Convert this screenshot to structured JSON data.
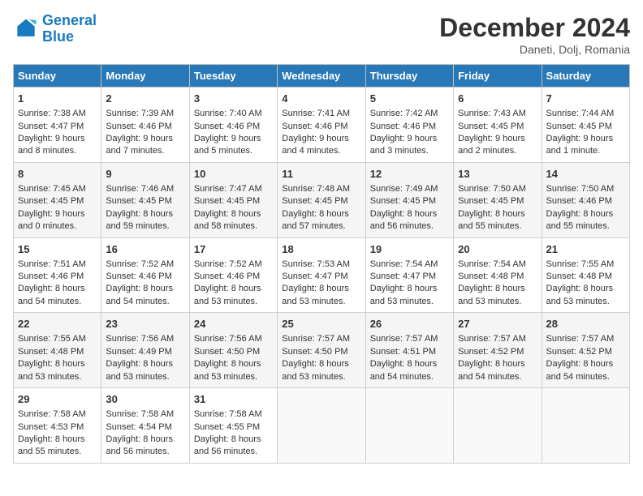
{
  "header": {
    "logo_line1": "General",
    "logo_line2": "Blue",
    "month": "December 2024",
    "location": "Daneti, Dolj, Romania"
  },
  "days_of_week": [
    "Sunday",
    "Monday",
    "Tuesday",
    "Wednesday",
    "Thursday",
    "Friday",
    "Saturday"
  ],
  "weeks": [
    [
      {
        "day": "1",
        "sunrise": "Sunrise: 7:38 AM",
        "sunset": "Sunset: 4:47 PM",
        "daylight": "Daylight: 9 hours and 8 minutes."
      },
      {
        "day": "2",
        "sunrise": "Sunrise: 7:39 AM",
        "sunset": "Sunset: 4:46 PM",
        "daylight": "Daylight: 9 hours and 7 minutes."
      },
      {
        "day": "3",
        "sunrise": "Sunrise: 7:40 AM",
        "sunset": "Sunset: 4:46 PM",
        "daylight": "Daylight: 9 hours and 5 minutes."
      },
      {
        "day": "4",
        "sunrise": "Sunrise: 7:41 AM",
        "sunset": "Sunset: 4:46 PM",
        "daylight": "Daylight: 9 hours and 4 minutes."
      },
      {
        "day": "5",
        "sunrise": "Sunrise: 7:42 AM",
        "sunset": "Sunset: 4:46 PM",
        "daylight": "Daylight: 9 hours and 3 minutes."
      },
      {
        "day": "6",
        "sunrise": "Sunrise: 7:43 AM",
        "sunset": "Sunset: 4:45 PM",
        "daylight": "Daylight: 9 hours and 2 minutes."
      },
      {
        "day": "7",
        "sunrise": "Sunrise: 7:44 AM",
        "sunset": "Sunset: 4:45 PM",
        "daylight": "Daylight: 9 hours and 1 minute."
      }
    ],
    [
      {
        "day": "8",
        "sunrise": "Sunrise: 7:45 AM",
        "sunset": "Sunset: 4:45 PM",
        "daylight": "Daylight: 9 hours and 0 minutes."
      },
      {
        "day": "9",
        "sunrise": "Sunrise: 7:46 AM",
        "sunset": "Sunset: 4:45 PM",
        "daylight": "Daylight: 8 hours and 59 minutes."
      },
      {
        "day": "10",
        "sunrise": "Sunrise: 7:47 AM",
        "sunset": "Sunset: 4:45 PM",
        "daylight": "Daylight: 8 hours and 58 minutes."
      },
      {
        "day": "11",
        "sunrise": "Sunrise: 7:48 AM",
        "sunset": "Sunset: 4:45 PM",
        "daylight": "Daylight: 8 hours and 57 minutes."
      },
      {
        "day": "12",
        "sunrise": "Sunrise: 7:49 AM",
        "sunset": "Sunset: 4:45 PM",
        "daylight": "Daylight: 8 hours and 56 minutes."
      },
      {
        "day": "13",
        "sunrise": "Sunrise: 7:50 AM",
        "sunset": "Sunset: 4:45 PM",
        "daylight": "Daylight: 8 hours and 55 minutes."
      },
      {
        "day": "14",
        "sunrise": "Sunrise: 7:50 AM",
        "sunset": "Sunset: 4:46 PM",
        "daylight": "Daylight: 8 hours and 55 minutes."
      }
    ],
    [
      {
        "day": "15",
        "sunrise": "Sunrise: 7:51 AM",
        "sunset": "Sunset: 4:46 PM",
        "daylight": "Daylight: 8 hours and 54 minutes."
      },
      {
        "day": "16",
        "sunrise": "Sunrise: 7:52 AM",
        "sunset": "Sunset: 4:46 PM",
        "daylight": "Daylight: 8 hours and 54 minutes."
      },
      {
        "day": "17",
        "sunrise": "Sunrise: 7:52 AM",
        "sunset": "Sunset: 4:46 PM",
        "daylight": "Daylight: 8 hours and 53 minutes."
      },
      {
        "day": "18",
        "sunrise": "Sunrise: 7:53 AM",
        "sunset": "Sunset: 4:47 PM",
        "daylight": "Daylight: 8 hours and 53 minutes."
      },
      {
        "day": "19",
        "sunrise": "Sunrise: 7:54 AM",
        "sunset": "Sunset: 4:47 PM",
        "daylight": "Daylight: 8 hours and 53 minutes."
      },
      {
        "day": "20",
        "sunrise": "Sunrise: 7:54 AM",
        "sunset": "Sunset: 4:48 PM",
        "daylight": "Daylight: 8 hours and 53 minutes."
      },
      {
        "day": "21",
        "sunrise": "Sunrise: 7:55 AM",
        "sunset": "Sunset: 4:48 PM",
        "daylight": "Daylight: 8 hours and 53 minutes."
      }
    ],
    [
      {
        "day": "22",
        "sunrise": "Sunrise: 7:55 AM",
        "sunset": "Sunset: 4:48 PM",
        "daylight": "Daylight: 8 hours and 53 minutes."
      },
      {
        "day": "23",
        "sunrise": "Sunrise: 7:56 AM",
        "sunset": "Sunset: 4:49 PM",
        "daylight": "Daylight: 8 hours and 53 minutes."
      },
      {
        "day": "24",
        "sunrise": "Sunrise: 7:56 AM",
        "sunset": "Sunset: 4:50 PM",
        "daylight": "Daylight: 8 hours and 53 minutes."
      },
      {
        "day": "25",
        "sunrise": "Sunrise: 7:57 AM",
        "sunset": "Sunset: 4:50 PM",
        "daylight": "Daylight: 8 hours and 53 minutes."
      },
      {
        "day": "26",
        "sunrise": "Sunrise: 7:57 AM",
        "sunset": "Sunset: 4:51 PM",
        "daylight": "Daylight: 8 hours and 54 minutes."
      },
      {
        "day": "27",
        "sunrise": "Sunrise: 7:57 AM",
        "sunset": "Sunset: 4:52 PM",
        "daylight": "Daylight: 8 hours and 54 minutes."
      },
      {
        "day": "28",
        "sunrise": "Sunrise: 7:57 AM",
        "sunset": "Sunset: 4:52 PM",
        "daylight": "Daylight: 8 hours and 54 minutes."
      }
    ],
    [
      {
        "day": "29",
        "sunrise": "Sunrise: 7:58 AM",
        "sunset": "Sunset: 4:53 PM",
        "daylight": "Daylight: 8 hours and 55 minutes."
      },
      {
        "day": "30",
        "sunrise": "Sunrise: 7:58 AM",
        "sunset": "Sunset: 4:54 PM",
        "daylight": "Daylight: 8 hours and 56 minutes."
      },
      {
        "day": "31",
        "sunrise": "Sunrise: 7:58 AM",
        "sunset": "Sunset: 4:55 PM",
        "daylight": "Daylight: 8 hours and 56 minutes."
      },
      null,
      null,
      null,
      null
    ]
  ]
}
